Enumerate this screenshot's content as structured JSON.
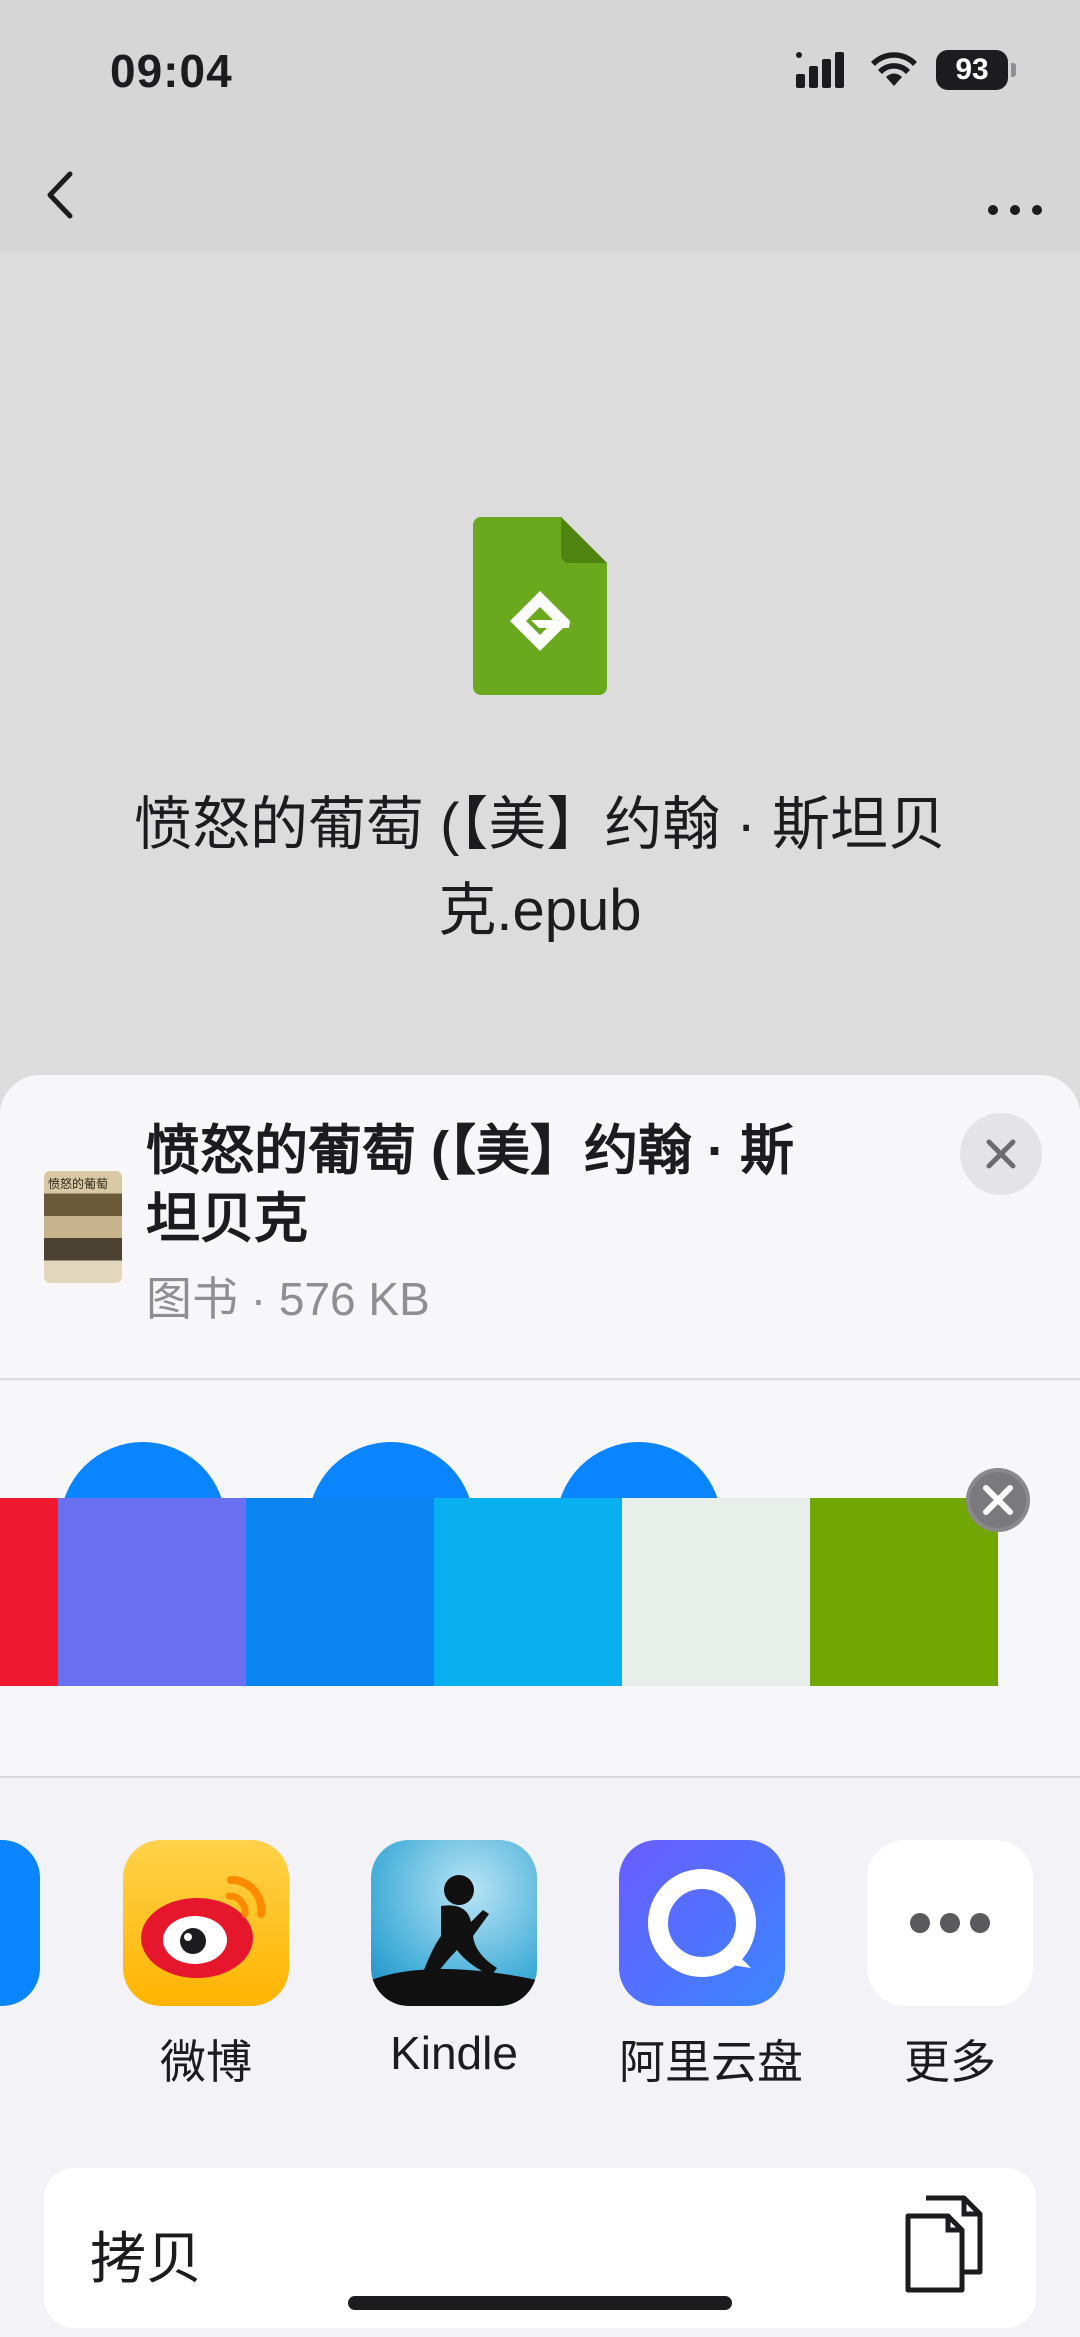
{
  "status_bar": {
    "time": "09:04",
    "battery": "93"
  },
  "nav": {
    "back_icon": "chevron-left-icon",
    "more_icon": "ellipsis-icon"
  },
  "preview": {
    "file_title": "愤怒的葡萄 (【美】约翰 · 斯坦贝克.epub",
    "icon": "epub-file-icon",
    "icon_color": "#6aa81e"
  },
  "share_sheet": {
    "title": "愤怒的葡萄 (【美】约翰 · 斯坦贝克",
    "meta": "图书 · 576 KB",
    "thumb_text": "愤怒的葡萄",
    "close_icon": "close-icon",
    "strip_colors": [
      "#ef1a31",
      "#6a6ff0",
      "#0a84f0",
      "#08b0f0",
      "#e8efea",
      "#72a600"
    ],
    "apps": [
      {
        "label": "微博",
        "icon": "weibo-icon"
      },
      {
        "label": "Kindle",
        "icon": "kindle-icon"
      },
      {
        "label": "阿里云盘",
        "icon": "aliyun-drive-icon"
      },
      {
        "label": "更多",
        "icon": "more-icon"
      }
    ],
    "copy_label": "拷贝",
    "copy_icon": "copy-icon"
  }
}
